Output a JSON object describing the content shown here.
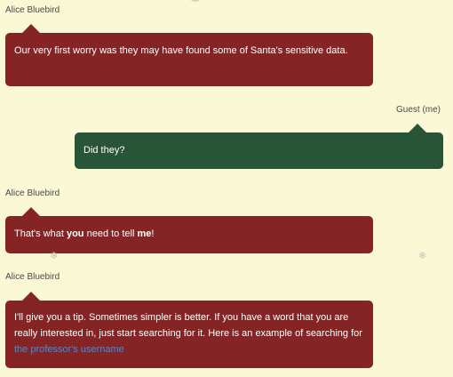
{
  "messages": [
    {
      "sender": "Alice Bluebird",
      "text": "Our very first worry was they may have found some of Santa's sensitive data."
    },
    {
      "sender": "Guest (me)",
      "text": "Did they?"
    },
    {
      "sender": "Alice Bluebird",
      "parts": [
        "That's what ",
        "you",
        " need to tell ",
        "me",
        "!"
      ]
    },
    {
      "sender": "Alice Bluebird",
      "text": "I'll give you a tip. Sometimes simpler is better. If you have a word that you are really interested in, just start searching for it. Here is an example of searching for ",
      "link": "the professor's username"
    }
  ],
  "decorations": {
    "snowflake": "❄"
  },
  "colors": {
    "them_bubble": "#852424",
    "me_bubble": "#285438",
    "background": "#fbf8d6",
    "link": "#3c8fe0"
  }
}
